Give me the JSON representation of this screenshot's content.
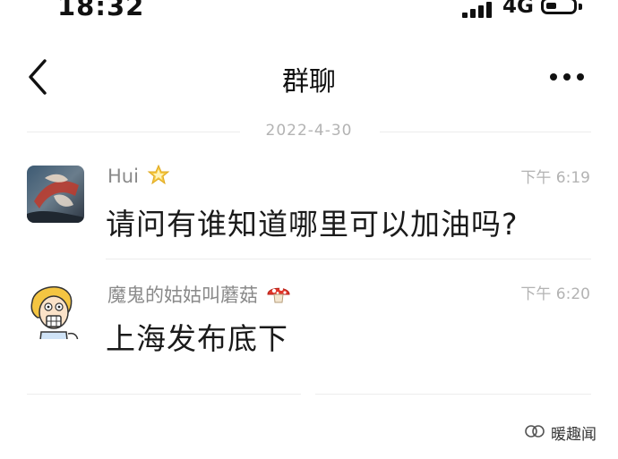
{
  "status_bar": {
    "time": "18:32",
    "network": "4G"
  },
  "header": {
    "title": "群聊"
  },
  "chat": {
    "date": "2022-4-30",
    "messages": [
      {
        "sender": "Hui",
        "badge_icon": "crown-star-icon",
        "time": "下午 6:19",
        "text": "请问有谁知道哪里可以加油吗?"
      },
      {
        "sender": "魔鬼的姑姑叫蘑菇",
        "badge_icon": "mushroom-icon",
        "time": "下午 6:20",
        "text": "上海发布底下"
      }
    ]
  },
  "watermark": {
    "text": "暖趣闻"
  }
}
